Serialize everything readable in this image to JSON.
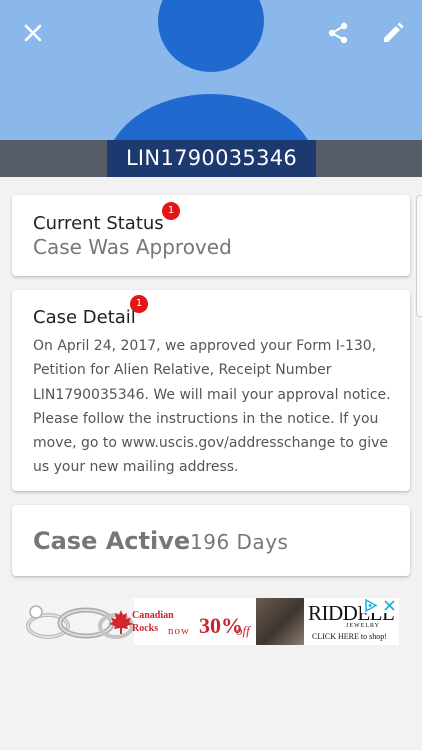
{
  "header": {
    "receipt_number": "LIN1790035346",
    "close_icon": "close-icon",
    "share_icon": "share-icon",
    "edit_icon": "edit-icon"
  },
  "status_card": {
    "title": "Current Status",
    "value": "Case Was Approved",
    "badge": "1"
  },
  "detail_card": {
    "title": "Case Detail",
    "badge": "1",
    "text": "On April 24, 2017, we approved your Form I-130, Petition for Alien Relative, Receipt Number LIN1790035346. We will mail your approval notice. Please follow the instructions in the notice. If you move, go to www.uscis.gov/addresschange to give us your new mailing address."
  },
  "active_card": {
    "label": "Case Active",
    "days": "196 Days"
  },
  "ad": {
    "brand_line1": "Canadian",
    "brand_line2": "Rocks",
    "now_text": "now",
    "percent": "30%",
    "off": "off",
    "logo": "RIDDELL'S",
    "logo_sub": "JEWELRY",
    "cta": "CLICK HERE to shop!",
    "adchoices_icon": "adchoices-icon",
    "ad_close_icon": "close-icon"
  },
  "colors": {
    "header_bg": "#8ab8ea",
    "avatar": "#1f69cf",
    "receipt_tab": "#1c3970",
    "receipt_bar": "#565d66",
    "badge": "#e21616",
    "page_bg": "#f2f2f2"
  }
}
